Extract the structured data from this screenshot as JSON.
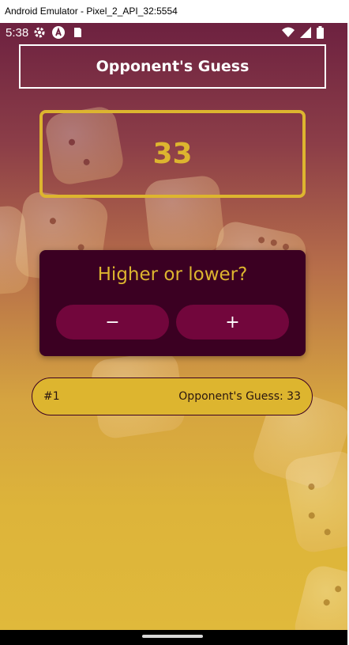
{
  "window": {
    "title": "Android Emulator - Pixel_2_API_32:5554"
  },
  "statusbar": {
    "time": "5:38",
    "left_icons": [
      "gear-icon",
      "a-circle-icon",
      "sd-card-icon"
    ],
    "right_icons": [
      "wifi-icon",
      "signal-icon",
      "battery-icon"
    ]
  },
  "header": {
    "title": "Opponent's Guess"
  },
  "guess": {
    "current": "33"
  },
  "prompt": {
    "title": "Higher or lower?",
    "minus_label": "−",
    "plus_label": "+"
  },
  "log": [
    {
      "round": "#1",
      "text": "Opponent's Guess: 33"
    }
  ],
  "colors": {
    "primary_dark": "#3b0022",
    "primary_button": "#72063c",
    "accent": "#ddb52f",
    "gradient_top": "#6d2140",
    "gradient_bottom": "#e0b93b"
  }
}
